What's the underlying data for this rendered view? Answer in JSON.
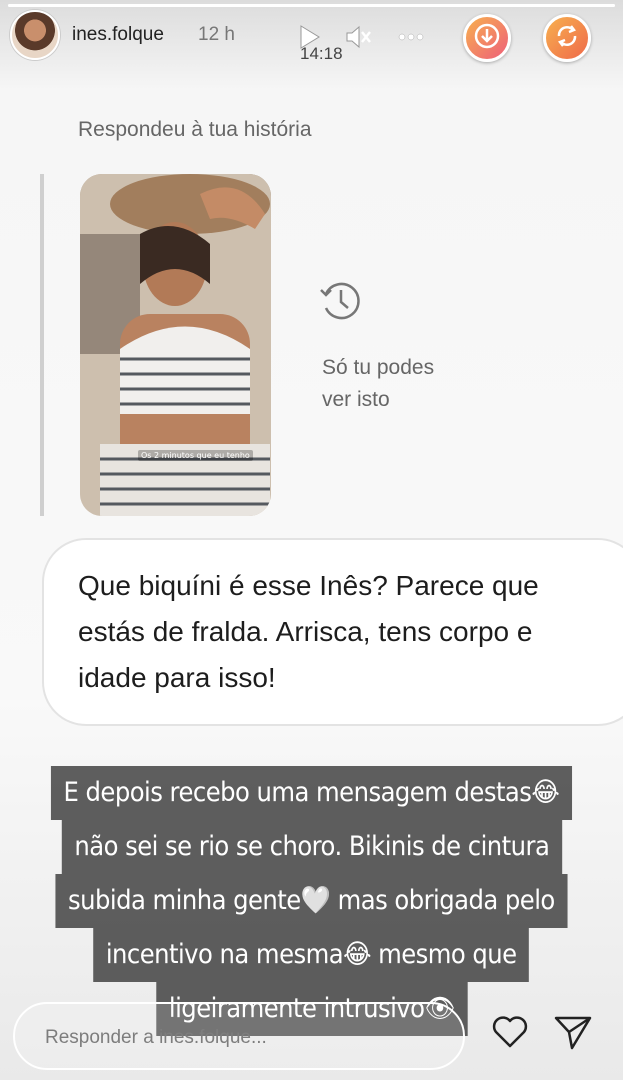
{
  "story": {
    "progress": 1.0
  },
  "header": {
    "username": "ines.folque",
    "time_ago": "12 h",
    "clock": "14:18",
    "icons": {
      "play": "play-icon",
      "mute": "mute-icon",
      "more": "more-icon",
      "download": "download-icon",
      "refresh": "refresh-icon"
    }
  },
  "reply_card": {
    "title": "Respondeu à tua história",
    "thumbnail_caption": "Os 2 minutos que eu tenho",
    "private_note_line1": "Só tu podes",
    "private_note_line2": "ver isto"
  },
  "message": {
    "text": "Que biquíni é esse Inês? Parece que estás de fralda. Arrisca, tens corpo e idade para isso!"
  },
  "caption": {
    "lines": [
      "E depois recebo uma mensagem destas😂",
      "não sei se rio se choro. Bikinis de cintura",
      "subida minha gente🤍 mas obrigada pelo",
      "incentivo na mesma😂 mesmo que",
      "ligeiramente intrusivo👁"
    ]
  },
  "reply_bar": {
    "placeholder": "Responder a ines.folque..."
  },
  "colors": {
    "accent_gradient_start": "#f7b04f",
    "accent_gradient_end": "#ee5f7a"
  }
}
